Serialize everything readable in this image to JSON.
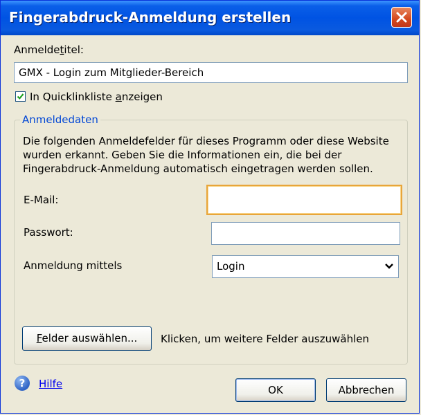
{
  "window": {
    "title": "Fingerabdruck-Anmeldung erstellen"
  },
  "login_title": {
    "label_pre": "Anmelde",
    "label_key": "t",
    "label_post": "itel:",
    "value": "GMX - Login zum Mitglieder-Bereich"
  },
  "quicklink": {
    "label_pre": "In Quicklinkliste ",
    "label_key": "a",
    "label_post": "nzeigen",
    "checked": true
  },
  "group": {
    "title": "Anmeldedaten",
    "description": [
      "Die folgenden Anmeldefelder für dieses Programm oder diese Website",
      "wurden erkannt. Geben Sie die Informationen ein, die bei der",
      "Fingerabdruck-Anmeldung automatisch eingetragen werden sollen."
    ],
    "email_label": "E-Mail:",
    "email_value": "",
    "password_label": "Passwort:",
    "password_value": "",
    "login_via_label": "Anmeldung mittels",
    "login_via_selected": "Login",
    "select_fields_key": "F",
    "select_fields_rest": "elder auswählen...",
    "select_fields_hint": "Klicken, um weitere Felder auszuwählen"
  },
  "footer": {
    "help_icon_glyph": "?",
    "help_link": "Hilfe",
    "ok": "OK",
    "cancel": "Abbrechen"
  },
  "colors": {
    "titlebar": "#0053e3",
    "focus_border": "#e8a53a",
    "group_title": "#0046d5",
    "close_button": "#d4481d"
  }
}
